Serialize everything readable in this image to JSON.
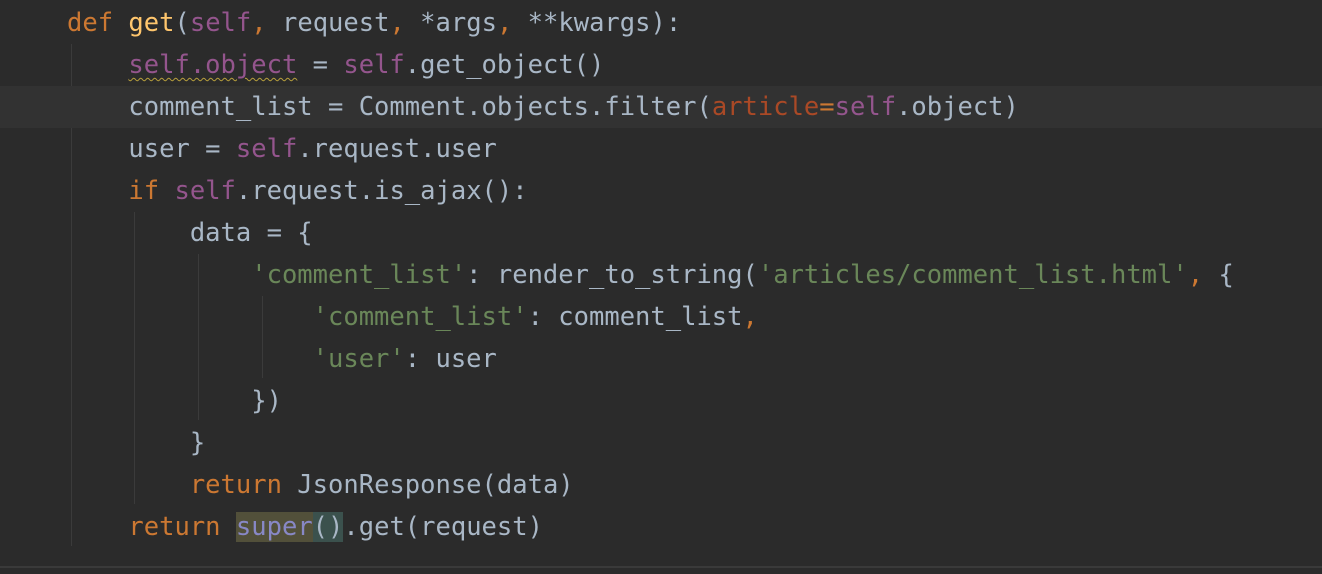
{
  "editor": {
    "language": "python",
    "current_line": 3,
    "highlighted_symbol": "super",
    "warning_symbol": "self.object",
    "colors": {
      "background": "#2b2b2b",
      "current_line": "#323232",
      "keyword": "#cc7832",
      "function_name": "#ffc66d",
      "self": "#94558d",
      "string": "#6a8759",
      "named_param": "#aa4926",
      "builtin": "#8888c6",
      "default_text": "#a9b7c6"
    },
    "tokens": {
      "l1": {
        "def": "def",
        "sp1": " ",
        "fname": "get",
        "open": "(",
        "self": "self",
        "comma1": ", ",
        "request": "request",
        "comma2": ", ",
        "args": "*args",
        "comma3": ", ",
        "kwargs": "**kwargs",
        "close": "):"
      },
      "l2": {
        "indent": "    ",
        "warn": "self.object",
        "rest": " = ",
        "self": "self",
        "tail": ".get_object()"
      },
      "l3": {
        "indent": "    ",
        "a": "comment_list = Comment.objects.filter(",
        "param": "article",
        "eq": "=",
        "self": "self",
        "tail": ".object)"
      },
      "l4": {
        "indent": "    ",
        "a": "user = ",
        "self": "self",
        "tail": ".request.user"
      },
      "l5": {
        "indent": "    ",
        "if": "if",
        "sp": " ",
        "self": "self",
        "tail": ".request.is_ajax():"
      },
      "l6": {
        "indent": "        ",
        "text": "data = {"
      },
      "l7": {
        "indent": "            ",
        "key": "'comment_list'",
        "a": ": render_to_string(",
        "path": "'articles/comment_list.html'",
        "comma": ",",
        "tail": " {"
      },
      "l8": {
        "indent": "                ",
        "key": "'comment_list'",
        "a": ": comment_list",
        "comma": ","
      },
      "l9": {
        "indent": "                ",
        "key": "'user'",
        "a": ": user"
      },
      "l10": {
        "indent": "            ",
        "text": "})"
      },
      "l11": {
        "indent": "        ",
        "text": "}"
      },
      "l12": {
        "indent": "        ",
        "ret": "return",
        "tail": " JsonResponse(data)"
      },
      "l13": {
        "indent": "    ",
        "ret": "return",
        "sp": " ",
        "super": "super",
        "paren": "()",
        "tail": ".get(request)"
      }
    }
  }
}
